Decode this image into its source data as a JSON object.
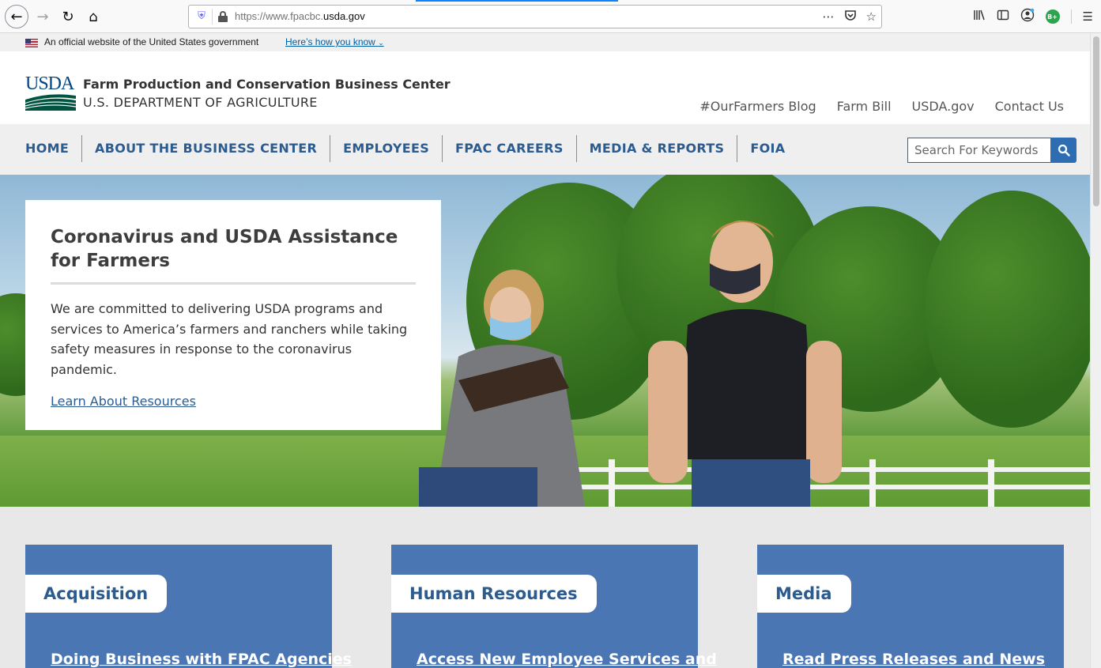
{
  "browser": {
    "url_prefix": "https://www.fpacbc.",
    "url_domain": "usda.gov",
    "icons": [
      "back-icon",
      "forward-icon",
      "reload-icon",
      "home-icon",
      "shield-icon",
      "lock-icon",
      "more-icon",
      "pocket-icon",
      "star-icon",
      "library-icon",
      "sidebar-icon",
      "account-icon",
      "extension-icon",
      "menu-icon"
    ],
    "extension_badge": "B+"
  },
  "gov_banner": {
    "text": "An official website of the United States government",
    "link": "Here’s how you know"
  },
  "header": {
    "logo_text": "USDA",
    "site_name": "Farm Production and Conservation Business Center",
    "dept_name": "U.S. DEPARTMENT OF AGRICULTURE",
    "top_links": [
      "#OurFarmers Blog",
      "Farm Bill",
      "USDA.gov",
      "Contact Us"
    ]
  },
  "nav": {
    "items": [
      "HOME",
      "ABOUT THE BUSINESS CENTER",
      "EMPLOYEES",
      "FPAC CAREERS",
      "MEDIA & REPORTS",
      "FOIA"
    ],
    "search_placeholder": "Search For Keywords"
  },
  "hero": {
    "title": "Coronavirus and USDA Assistance for Farmers",
    "body": "We are committed to delivering USDA programs and services to America’s farmers and ranchers while taking safety measures in response to the coronavirus pandemic.",
    "link": "Learn About Resources"
  },
  "cards": [
    {
      "title": "Acquisition",
      "link": "Doing Business with FPAC Agencies"
    },
    {
      "title": "Human Resources",
      "link": "Access New Employee Services and"
    },
    {
      "title": "Media",
      "link": "Read Press Releases and News"
    }
  ],
  "colors": {
    "brand_blue": "#2b5b8f",
    "card_blue": "#4a76b4",
    "search_button": "#2f6db3"
  }
}
